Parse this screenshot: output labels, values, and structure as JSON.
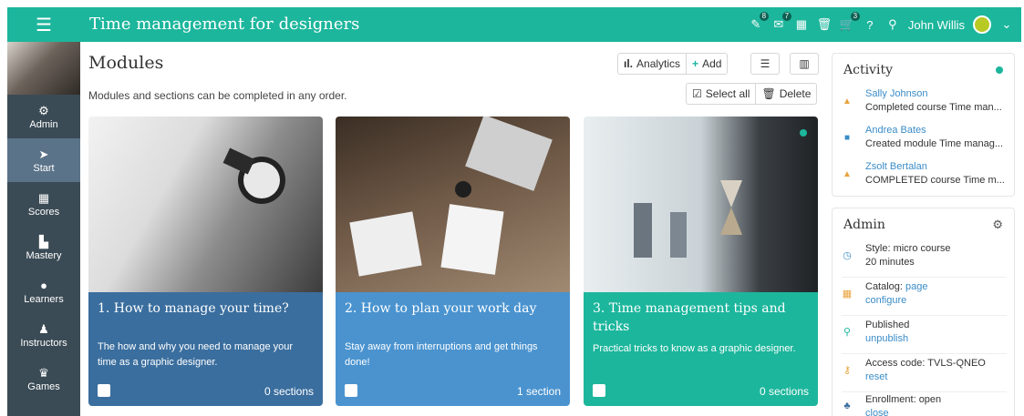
{
  "header": {
    "title": "Time management for designers",
    "badges": [
      "8",
      "7",
      "3"
    ],
    "user_name": "John Willis"
  },
  "sidebar": {
    "items": [
      {
        "label": "Admin",
        "icon": "gear-icon"
      },
      {
        "label": "Start",
        "icon": "paper-plane-icon"
      },
      {
        "label": "Scores",
        "icon": "table-icon"
      },
      {
        "label": "Mastery",
        "icon": "bar-chart-icon"
      },
      {
        "label": "Learners",
        "icon": "user-icon"
      },
      {
        "label": "Instructors",
        "icon": "instructor-icon"
      },
      {
        "label": "Games",
        "icon": "trophy-icon"
      }
    ]
  },
  "main": {
    "title": "Modules",
    "description": "Modules and sections can be completed in any order.",
    "toolbar": {
      "analytics_label": "Analytics",
      "add_label": "Add",
      "select_all_label": "Select all",
      "delete_label": "Delete"
    },
    "cards": [
      {
        "title": "1. How to manage your time?",
        "description": "The how and why you need to manage your time as a graphic designer.",
        "sections": "0 sections",
        "color": "#3a6e9e"
      },
      {
        "title": "2. How to plan your work day",
        "description": "Stay away from interruptions and get things done!",
        "sections": "1 section",
        "color": "#4a93cf"
      },
      {
        "title": "3. Time management tips and tricks",
        "description": "Practical tricks to know as a graphic designer.",
        "sections": "0 sections",
        "color": "#1cb69c"
      }
    ]
  },
  "activity": {
    "title": "Activity",
    "items": [
      {
        "name": "Sally Johnson",
        "text": "Completed course Time man..."
      },
      {
        "name": "Andrea Bates",
        "text": "Created module Time manag..."
      },
      {
        "name": "Zsolt Bertalan",
        "text": "COMPLETED course Time m..."
      }
    ]
  },
  "admin": {
    "title": "Admin",
    "style_label": "Style: micro course",
    "style_sub": "20 minutes",
    "catalog_label": "Catalog:",
    "catalog_value": "page",
    "catalog_link": "configure",
    "published_label": "Published",
    "published_link": "unpublish",
    "access_label": "Access code: TVLS-QNEO",
    "access_link": "reset",
    "enrollment_label": "Enrollment: open",
    "enrollment_link": "close"
  },
  "colors": {
    "brand": "#1cb69c",
    "sidebar": "#3b4b55",
    "sidebar_active": "#5b7388",
    "link": "#3a8cc7"
  }
}
